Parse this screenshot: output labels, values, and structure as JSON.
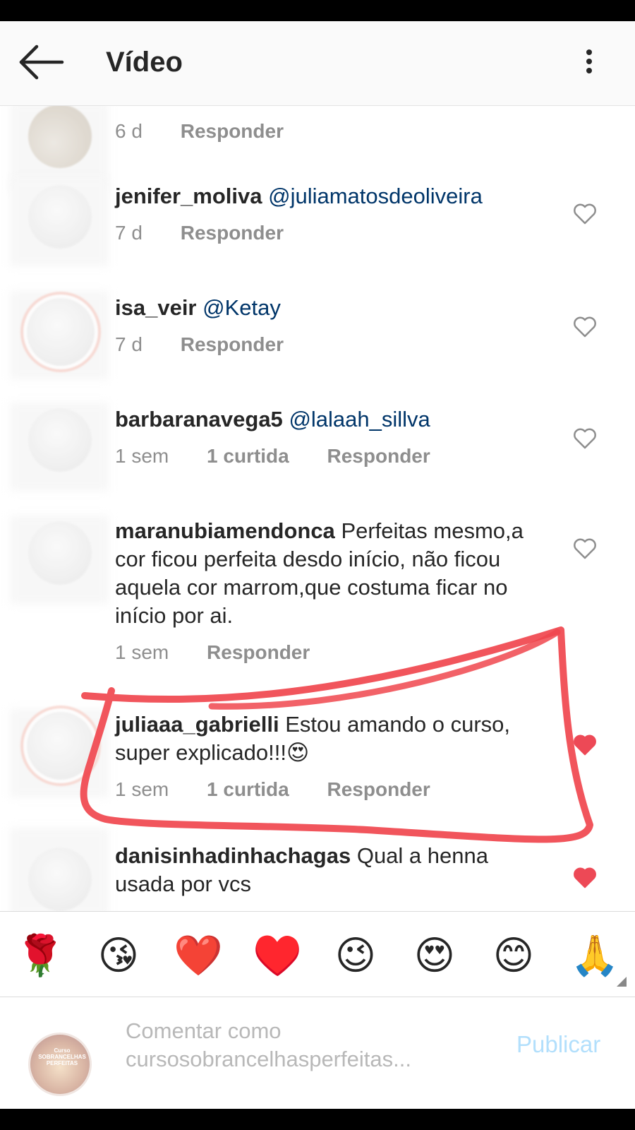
{
  "header": {
    "title": "Vídeo"
  },
  "comments": [
    {
      "username": "",
      "text": "",
      "mention": "",
      "time": "6 d",
      "likes": "",
      "reply_label": "Responder"
    },
    {
      "username": "jenifer_moliva",
      "mention": "@juliamatosdeoliveira",
      "text": "",
      "time": "7 d",
      "likes": "",
      "reply_label": "Responder"
    },
    {
      "username": "isa_veir",
      "mention": "@Ketay",
      "text": "",
      "time": "7 d",
      "likes": "",
      "reply_label": "Responder"
    },
    {
      "username": "barbaranavega5",
      "mention": "@lalaah_sillva",
      "text": "",
      "time": "1 sem",
      "likes": "1 curtida",
      "reply_label": "Responder"
    },
    {
      "username": "maranubiamendonca",
      "mention": "",
      "text": "Perfeitas mesmo,a cor ficou perfeita desdo início, não ficou aquela cor marrom,que costuma ficar no início por ai.",
      "time": "1 sem",
      "likes": "",
      "reply_label": "Responder"
    },
    {
      "username": "juliaaa_gabrielli",
      "mention": "",
      "text": "Estou amando o curso, super explicado!!!😍",
      "time": "1 sem",
      "likes": "1 curtida",
      "reply_label": "Responder"
    },
    {
      "username": "danisinhadinhachagas",
      "mention": "",
      "text": "Qual a henna usada por vcs",
      "time": "",
      "likes": "",
      "reply_label": ""
    }
  ],
  "emoji_bar": [
    "🌹",
    "😘",
    "❤️",
    "♥️",
    "😉",
    "😍",
    "😊",
    "🙏"
  ],
  "composer": {
    "placeholder_line1": "Comentar como",
    "placeholder_line2": "cursosobrancelhasperfeitas...",
    "publish_label": "Publicar",
    "avatar_logo_text": "Curso SOBRANCELHAS PERFEITAS"
  },
  "colors": {
    "mention": "#003569",
    "meta": "#8e8e8e",
    "publish": "#b2dffc",
    "liked_heart": "#ed4956",
    "annotation": "#f0474e"
  }
}
